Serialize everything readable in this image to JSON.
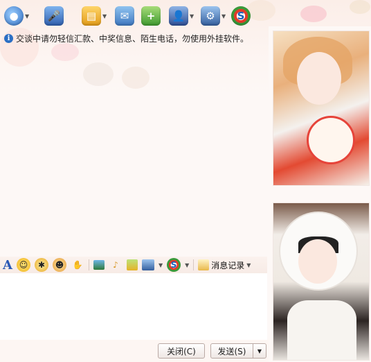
{
  "notice": {
    "icon": "info-icon",
    "text": "交谈中请勿轻信汇款、中奖信息、陌生电话，勿使用外挂软件。"
  },
  "toolbar": {
    "items": [
      {
        "icon": "webcam-icon",
        "has_dropdown": true
      },
      {
        "icon": "microphone-icon",
        "has_dropdown": false
      },
      {
        "icon": "folder-transfer-icon",
        "has_dropdown": true
      },
      {
        "icon": "email-icon",
        "has_dropdown": false
      },
      {
        "icon": "add-app-icon",
        "has_dropdown": false
      },
      {
        "icon": "contact-card-icon",
        "has_dropdown": true
      },
      {
        "icon": "settings-app-icon",
        "has_dropdown": true
      },
      {
        "icon": "sogou-icon",
        "has_dropdown": false
      }
    ]
  },
  "format_bar": {
    "font_label": "A",
    "history_label": "消息记录"
  },
  "buttons": {
    "close": "关闭(C)",
    "send": "发送(S)"
  },
  "colors": {
    "accent": "#2b6fc4",
    "background": "#fdf8f6"
  }
}
